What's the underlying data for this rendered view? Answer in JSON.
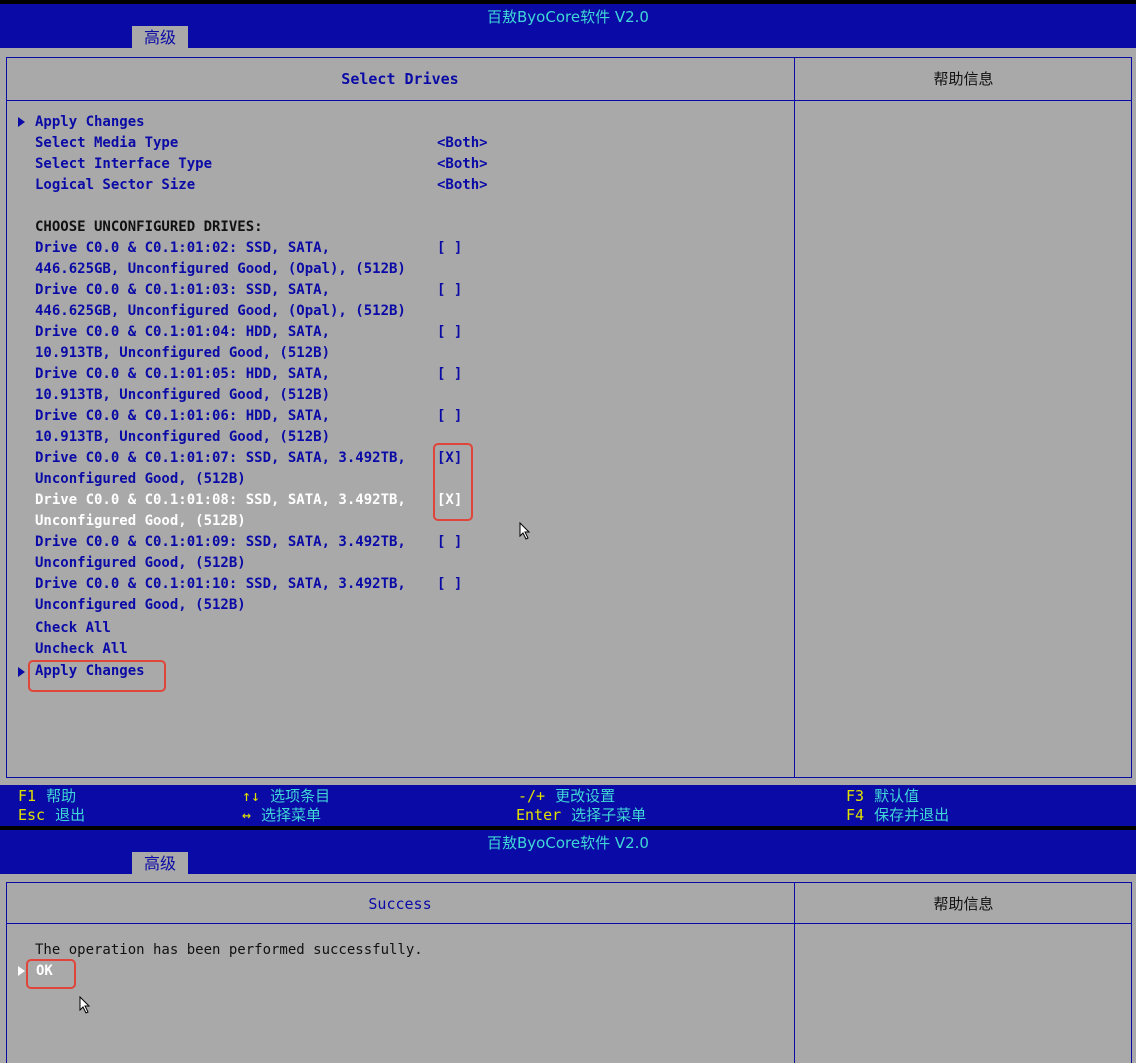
{
  "app_title": "百敖ByoCore软件 V2.0",
  "tab_label": "高级",
  "screen1": {
    "panel_title": "Select Drives",
    "help_title": "帮助信息",
    "top_items": [
      {
        "label": "Apply Changes",
        "value": ""
      },
      {
        "label": "Select Media Type",
        "value": "<Both>"
      },
      {
        "label": "Select Interface Type",
        "value": "<Both>"
      },
      {
        "label": "Logical Sector Size",
        "value": "<Both>"
      }
    ],
    "section_heading": "CHOOSE UNCONFIGURED DRIVES:",
    "drives": [
      {
        "line1": "Drive C0.0 & C0.1:01:02: SSD, SATA,",
        "line2": "446.625GB, Unconfigured Good, (Opal), (512B)",
        "check": "[ ]"
      },
      {
        "line1": "Drive C0.0 & C0.1:01:03: SSD, SATA,",
        "line2": "446.625GB, Unconfigured Good, (Opal), (512B)",
        "check": "[ ]"
      },
      {
        "line1": "Drive C0.0 & C0.1:01:04: HDD, SATA,",
        "line2": "10.913TB, Unconfigured Good, (512B)",
        "check": "[ ]"
      },
      {
        "line1": "Drive C0.0 & C0.1:01:05: HDD, SATA,",
        "line2": "10.913TB, Unconfigured Good, (512B)",
        "check": "[ ]"
      },
      {
        "line1": "Drive C0.0 & C0.1:01:06: HDD, SATA,",
        "line2": "10.913TB, Unconfigured Good, (512B)",
        "check": "[ ]"
      },
      {
        "line1": "Drive C0.0 & C0.1:01:07: SSD, SATA, 3.492TB,",
        "line2": "Unconfigured Good, (512B)",
        "check": "[X]"
      },
      {
        "line1": "Drive C0.0 & C0.1:01:08: SSD, SATA, 3.492TB,",
        "line2": "Unconfigured Good, (512B)",
        "check": "[X]"
      },
      {
        "line1": "Drive C0.0 & C0.1:01:09: SSD, SATA, 3.492TB,",
        "line2": "Unconfigured Good, (512B)",
        "check": "[ ]"
      },
      {
        "line1": "Drive C0.0 & C0.1:01:10: SSD, SATA, 3.492TB,",
        "line2": "Unconfigured Good, (512B)",
        "check": "[ ]"
      }
    ],
    "check_all": "Check All",
    "uncheck_all": "Uncheck All",
    "apply_changes_bottom": "Apply Changes",
    "footer": {
      "f1_key": "F1",
      "f1_desc": "帮助",
      "esc_key": "Esc",
      "esc_desc": "退出",
      "updown_key": "↑↓",
      "updown_desc": "选项条目",
      "leftright_key": "↔",
      "leftright_desc": "选择菜单",
      "pm_key": "-/+",
      "pm_desc": "更改设置",
      "enter_key": "Enter",
      "enter_desc": "选择子菜单",
      "f3_key": "F3",
      "f3_desc": "默认值",
      "f4_key": "F4",
      "f4_desc": "保存并退出"
    }
  },
  "screen2": {
    "panel_title": "Success",
    "help_title": "帮助信息",
    "message": "The operation has been performed successfully.",
    "ok_label": "OK"
  },
  "colors": {
    "bios_blue": "#0a0aa6",
    "bios_gray": "#a9a9a9",
    "title_cyan": "#3fd7d7",
    "highlight_red": "#e0453a"
  }
}
